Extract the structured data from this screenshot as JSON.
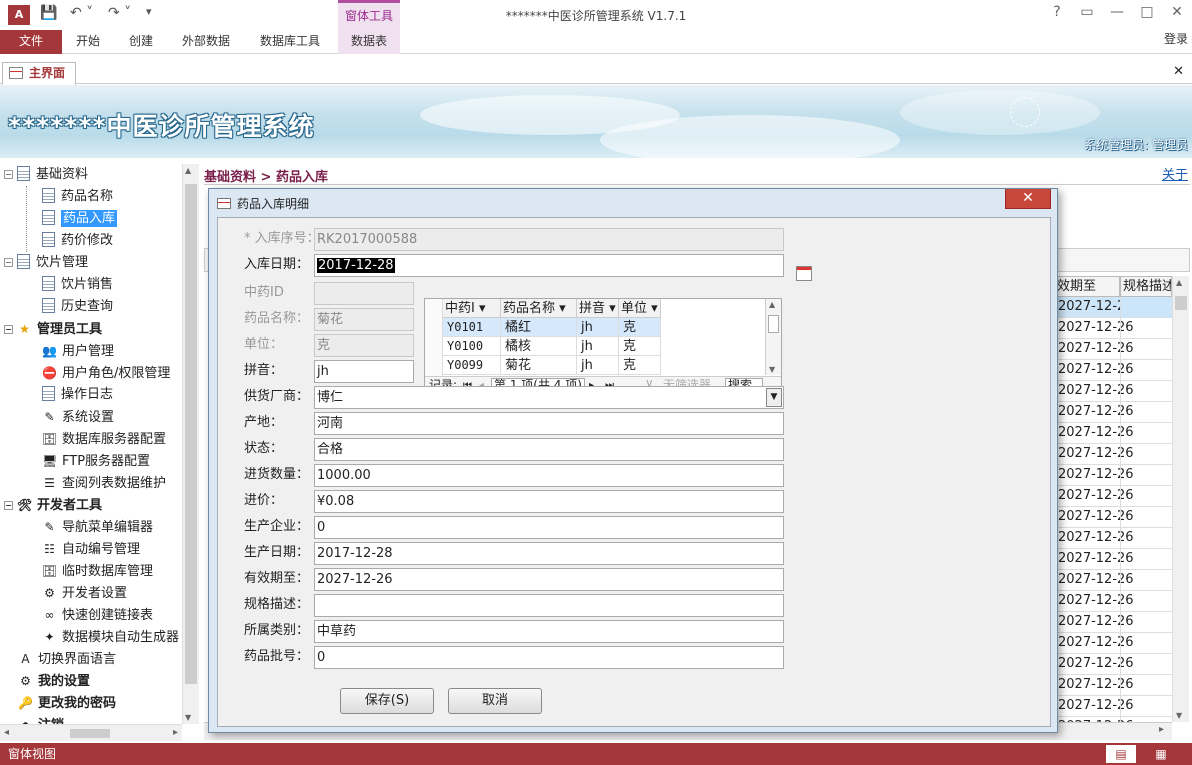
{
  "titlebar": {
    "app_title": "*******中医诊所管理系统 V1.7.1",
    "context_group": "窗体工具",
    "help": "?",
    "minimize": "—",
    "restore": "□",
    "close": "✕"
  },
  "ribbon": {
    "tabs": [
      "文件",
      "开始",
      "创建",
      "外部数据",
      "数据库工具",
      "数据表"
    ],
    "login": "登录"
  },
  "doc_tab": {
    "label": "主界面",
    "close": "✕"
  },
  "banner": {
    "title": "*******中医诊所管理系统",
    "user": "系统管理员: 管理员"
  },
  "nav": {
    "items": [
      {
        "label": "基础资料",
        "level": 0,
        "expander": "−",
        "icon": "doc-icon",
        "bold": false
      },
      {
        "label": "药品名称",
        "level": 1,
        "icon": "doc-icon"
      },
      {
        "label": "药品入库",
        "level": 1,
        "icon": "doc-icon",
        "selected": true
      },
      {
        "label": "药价修改",
        "level": 1,
        "icon": "doc-icon"
      },
      {
        "label": "饮片管理",
        "level": 0,
        "expander": "−",
        "icon": "doc-icon"
      },
      {
        "label": "饮片销售",
        "level": 1,
        "icon": "doc-icon"
      },
      {
        "label": "历史查询",
        "level": 1,
        "icon": "doc-icon"
      },
      {
        "label": "管理员工具",
        "level": 0,
        "expander": "−",
        "icon": "star-icon",
        "bold": true
      },
      {
        "label": "用户管理",
        "level": 1,
        "icon": "users-icon"
      },
      {
        "label": "用户角色/权限管理",
        "level": 1,
        "icon": "no-entry-icon"
      },
      {
        "label": "操作日志",
        "level": 1,
        "icon": "doc-icon"
      },
      {
        "label": "系统设置",
        "level": 1,
        "icon": "edit-icon"
      },
      {
        "label": "数据库服务器配置",
        "level": 1,
        "icon": "database-icon"
      },
      {
        "label": "FTP服务器配置",
        "level": 1,
        "icon": "server-icon"
      },
      {
        "label": "查阅列表数据维护",
        "level": 1,
        "icon": "list-icon"
      },
      {
        "label": "开发者工具",
        "level": 0,
        "expander": "−",
        "icon": "tools-icon",
        "bold": true
      },
      {
        "label": "导航菜单编辑器",
        "level": 1,
        "icon": "edit-icon"
      },
      {
        "label": "自动编号管理",
        "level": 1,
        "icon": "numbered-list-icon"
      },
      {
        "label": "临时数据库管理",
        "level": 1,
        "icon": "database-icon"
      },
      {
        "label": "开发者设置",
        "level": 1,
        "icon": "gear-icon"
      },
      {
        "label": "快速创建链接表",
        "level": 1,
        "icon": "link-icon"
      },
      {
        "label": "数据模块自动生成器",
        "level": 1,
        "icon": "wand-icon"
      },
      {
        "label": "切换界面语言",
        "level": 0,
        "icon": "language-icon"
      },
      {
        "label": "我的设置",
        "level": 0,
        "icon": "settings-icon",
        "bold": true
      },
      {
        "label": "更改我的密码",
        "level": 0,
        "icon": "key-icon",
        "bold": true
      },
      {
        "label": "注销",
        "level": 0,
        "icon": "logout-icon",
        "bold": true
      }
    ]
  },
  "content": {
    "breadcrumb": "基础资料 > 药品入库",
    "about": "关于",
    "grid_headers": [
      "效期至",
      "规格描述"
    ],
    "grid_dates": [
      "2027-12-26",
      "2027-12-26",
      "2027-12-26",
      "2027-12-26",
      "2027-12-26",
      "2027-12-26",
      "2027-12-26",
      "2027-12-26",
      "2027-12-26",
      "2027-12-26",
      "2027-12-26",
      "2027-12-26",
      "2027-12-26",
      "2027-12-26",
      "2027-12-26",
      "2027-12-26",
      "2027-12-26",
      "2027-12-26",
      "2027-12-26",
      "2027-12-26",
      "2027-12-26"
    ]
  },
  "dialog": {
    "title": "药品入库明细",
    "close": "✕",
    "fields": {
      "seq": {
        "label": "* 入库序号：",
        "value": "RK2017000588"
      },
      "in_date": {
        "label": "入库日期：",
        "value": "2017-12-28"
      },
      "herb_id": {
        "label": "中药ID",
        "value": ""
      },
      "drug_name": {
        "label": "药品名称：",
        "value": "菊花"
      },
      "unit": {
        "label": "单位：",
        "value": "克"
      },
      "pinyin": {
        "label": "拼音：",
        "value": "jh"
      },
      "supplier": {
        "label": "供货厂商：",
        "value": "博仁"
      },
      "origin": {
        "label": "产地：",
        "value": "河南"
      },
      "status": {
        "label": "状态：",
        "value": "合格"
      },
      "qty": {
        "label": "进货数量：",
        "value": "1000.00"
      },
      "price": {
        "label": "进价：",
        "value": "¥0.08"
      },
      "manufacturer": {
        "label": "生产企业：",
        "value": "0"
      },
      "prod_date": {
        "label": "生产日期：",
        "value": "2017-12-28"
      },
      "expiry": {
        "label": "有效期至：",
        "value": "2027-12-26"
      },
      "spec": {
        "label": "规格描述：",
        "value": ""
      },
      "category": {
        "label": "所属类别：",
        "value": "中草药"
      },
      "batch": {
        "label": "药品批号：",
        "value": "0"
      }
    },
    "subform": {
      "headers": [
        "中药I ▾",
        "药品名称 ▾",
        "拼音 ▾",
        "单位 ▾"
      ],
      "rows": [
        [
          "Y0101",
          "橘红",
          "jh",
          "克"
        ],
        [
          "Y0100",
          "橘核",
          "jh",
          "克"
        ],
        [
          "Y0099",
          "菊花",
          "jh",
          "克"
        ]
      ],
      "nav_label": "记录:",
      "nav_pos": "第 1 项(共 4 项)",
      "nav_first": "⏮",
      "nav_prev": "◂",
      "nav_next": "▸",
      "nav_last": "⏭",
      "filter": "无筛选器",
      "search": "搜索"
    },
    "save": "保存(S)",
    "cancel": "取消"
  },
  "status": {
    "label": "窗体视图"
  },
  "colors": {
    "accent": "#a4373a",
    "context": "#b04fa0",
    "selected": "#3399ff",
    "breadcrumb": "#7a1f4a"
  }
}
